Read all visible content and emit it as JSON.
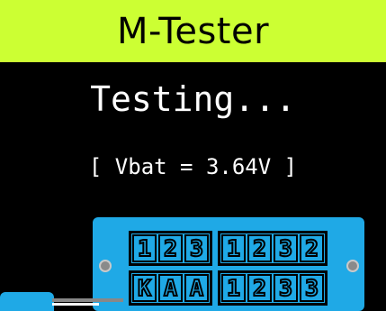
{
  "header": {
    "title": "M-Tester"
  },
  "status": {
    "message": "Testing...",
    "vbat_line": "[ Vbat = 3.64V ]"
  },
  "module_display": {
    "rows": [
      {
        "groups": [
          [
            "1",
            "2",
            "3"
          ],
          [
            "1",
            "2",
            "3",
            "2"
          ]
        ]
      },
      {
        "groups": [
          [
            "K",
            "A",
            "A"
          ],
          [
            "1",
            "2",
            "3",
            "3"
          ]
        ]
      }
    ]
  },
  "colors": {
    "title_bar": "#ccff33",
    "screen_bg": "#000000",
    "module": "#1fa9e6",
    "text": "#ffffff"
  }
}
